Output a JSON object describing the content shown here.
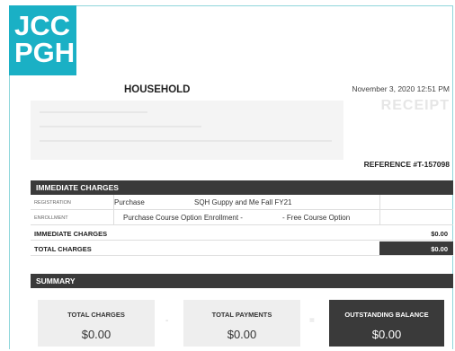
{
  "logo": {
    "line1": "JCC",
    "line2": "PGH"
  },
  "header": {
    "household_label": "HOUSEHOLD",
    "datetime": "November 3, 2020 12:51 PM",
    "receipt_label": "RECEIPT",
    "reference": "REFERENCE #T-157098"
  },
  "immediate_charges": {
    "title": "IMMEDIATE CHARGES",
    "rows": [
      {
        "type": "REGISTRATION",
        "action": "Purchase",
        "description": "SQH Guppy and Me Fall FY21"
      },
      {
        "type": "ENROLLMENT",
        "action": "Purchase Course Option Enrollment -",
        "description": "- Free Course Option"
      }
    ],
    "subtotal_label": "IMMEDIATE CHARGES",
    "subtotal_value": "$0.00",
    "total_label": "TOTAL CHARGES",
    "total_value": "$0.00"
  },
  "summary": {
    "title": "SUMMARY",
    "total_charges_label": "TOTAL CHARGES",
    "total_charges_value": "$0.00",
    "minus": "-",
    "total_payments_label": "TOTAL PAYMENTS",
    "total_payments_value": "$0.00",
    "equals": "=",
    "outstanding_label": "OUTSTANDING BALANCE",
    "outstanding_value": "$0.00"
  },
  "colors": {
    "brand": "#1ab0c5",
    "dark_bar": "#3a3a3a",
    "summary_box": "#eeeeee",
    "receipt_grey": "#e6e6e6"
  }
}
